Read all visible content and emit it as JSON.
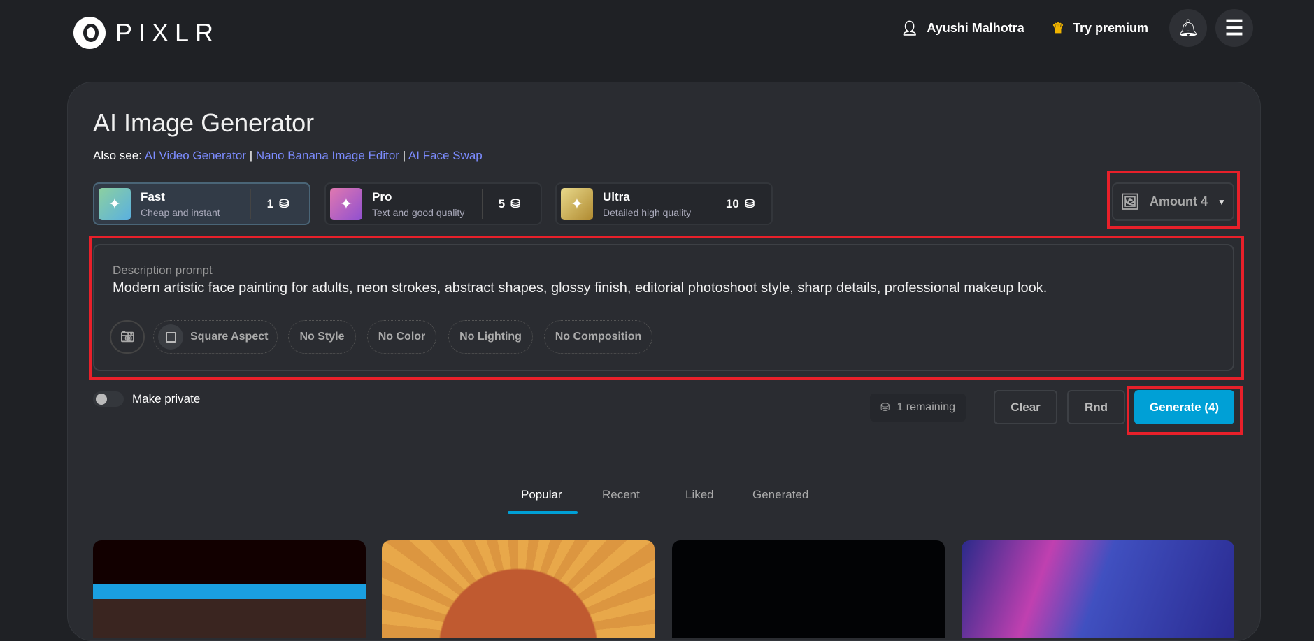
{
  "header": {
    "brand": "PIXLR",
    "user_name": "Ayushi Malhotra",
    "premium_label": "Try premium"
  },
  "page": {
    "title": "AI Image Generator",
    "also_see_label": "Also see:",
    "links": [
      "AI Video Generator",
      "Nano Banana Image Editor",
      "AI Face Swap"
    ],
    "separator": "|"
  },
  "modes": [
    {
      "name": "Fast",
      "desc": "Cheap and instant",
      "cost": "1",
      "selected": true
    },
    {
      "name": "Pro",
      "desc": "Text and good quality",
      "cost": "5"
    },
    {
      "name": "Ultra",
      "desc": "Detailed high quality",
      "cost": "10"
    }
  ],
  "amount": {
    "label": "Amount 4"
  },
  "prompt": {
    "label": "Description prompt",
    "value": "Modern artistic face painting for adults, neon strokes, abstract shapes, glossy finish, editorial photoshoot style, sharp details, professional makeup look."
  },
  "chips": [
    "Square Aspect",
    "No Style",
    "No Color",
    "No Lighting",
    "No Composition"
  ],
  "private": {
    "label": "Make private",
    "on": false
  },
  "actions": {
    "remaining": "1 remaining",
    "clear": "Clear",
    "rnd": "Rnd",
    "generate": "Generate (4)"
  },
  "tabs": [
    "Popular",
    "Recent",
    "Liked",
    "Generated"
  ],
  "colors": {
    "accent": "#00a0d6",
    "link": "#7c8cff",
    "highlight": "#e8202a"
  }
}
